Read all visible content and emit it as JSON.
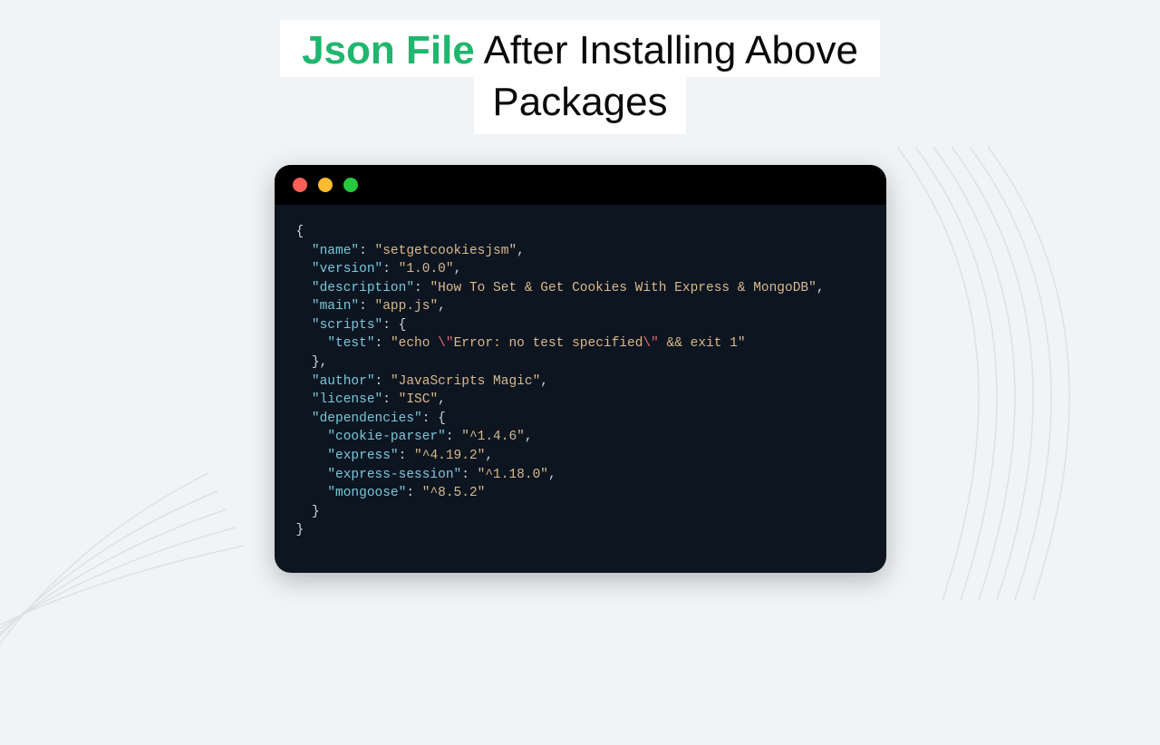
{
  "title": {
    "accent": "Json File",
    "rest": " After Installing Above",
    "line2": "Packages"
  },
  "colors": {
    "accent": "#1fb66e",
    "terminal_bg": "#0d1521",
    "key": "#7cc7d9",
    "string": "#d9b98a",
    "escape": "#e06c75"
  },
  "package_json": {
    "name": "setgetcookiesjsm",
    "version": "1.0.0",
    "description": "How To Set & Get Cookies With Express & MongoDB",
    "main": "app.js",
    "scripts": {
      "test": "echo \"Error: no test specified\" && exit 1"
    },
    "author": "JavaScripts Magic",
    "license": "ISC",
    "dependencies": {
      "cookie-parser": "^1.4.6",
      "express": "^4.19.2",
      "express-session": "^1.18.0",
      "mongoose": "^8.5.2"
    }
  },
  "test_display": {
    "prefix": "echo ",
    "esc1": "\\\"",
    "mid": "Error: no test specified",
    "esc2": "\\\"",
    "suffix": " && exit 1"
  }
}
